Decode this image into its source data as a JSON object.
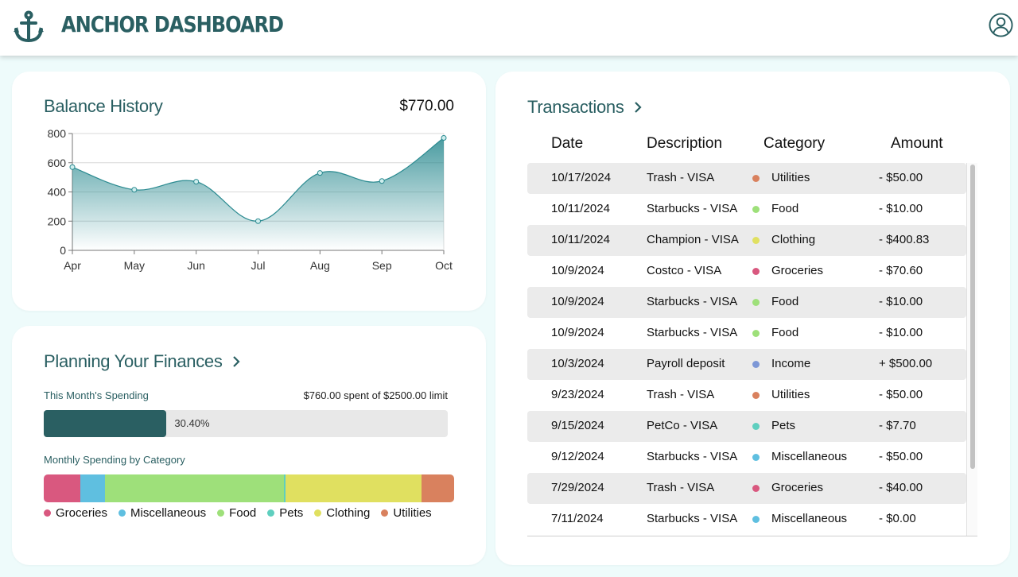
{
  "header": {
    "title": "ANCHOR DASHBOARD",
    "logo_icon": "anchor-icon",
    "profile_icon": "user-circle-icon",
    "brand_color": "#2a5f62"
  },
  "balance": {
    "title": "Balance History",
    "amount": "$770.00"
  },
  "chart_data": {
    "type": "area",
    "categories": [
      "Apr",
      "May",
      "Jun",
      "Jul",
      "Aug",
      "Sep",
      "Oct"
    ],
    "x": [
      "Apr",
      "May",
      "Jun",
      "Jul",
      "Aug",
      "Sep",
      "Oct"
    ],
    "series": [
      {
        "values": [
          570,
          415,
          470,
          200,
          530,
          475,
          770
        ]
      }
    ],
    "yticks": [
      "0",
      "200",
      "400",
      "600",
      "800"
    ],
    "ylim": [
      0,
      800
    ],
    "grid": true,
    "color": "#2a8a90"
  },
  "planning": {
    "title": "Planning Your Finances",
    "spending_label": "This Month's Spending",
    "spending_summary": "$760.00 spent of $2500.00 limit",
    "progress_fraction": 0.304,
    "progress_text": "30.40%",
    "category_label": "Monthly Spending by Category",
    "categories": [
      {
        "name": "Groceries",
        "color": "#d9587f",
        "share": 0.09
      },
      {
        "name": "Miscellaneous",
        "color": "#5fbfe0",
        "share": 0.06
      },
      {
        "name": "Food",
        "color": "#9ee07a",
        "share": 0.435
      },
      {
        "name": "Pets",
        "color": "#5fcfbf",
        "share": 0.005
      },
      {
        "name": "Clothing",
        "color": "#e0e060",
        "share": 0.33
      },
      {
        "name": "Utilities",
        "color": "#d9815e",
        "share": 0.08
      }
    ]
  },
  "transactions": {
    "title": "Transactions",
    "columns": [
      "Date",
      "Description",
      "Category",
      "Amount"
    ],
    "rows": [
      {
        "date": "10/17/2024",
        "description": "Trash - VISA",
        "category": "Utilities",
        "color": "#d9815e",
        "amount": "- $50.00"
      },
      {
        "date": "10/11/2024",
        "description": "Starbucks - VISA",
        "category": "Food",
        "color": "#9ee07a",
        "amount": "- $10.00"
      },
      {
        "date": "10/11/2024",
        "description": "Champion - VISA",
        "category": "Clothing",
        "color": "#e0e060",
        "amount": "- $400.83"
      },
      {
        "date": "10/9/2024",
        "description": "Costco - VISA",
        "category": "Groceries",
        "color": "#d9587f",
        "amount": "- $70.60"
      },
      {
        "date": "10/9/2024",
        "description": "Starbucks - VISA",
        "category": "Food",
        "color": "#9ee07a",
        "amount": "- $10.00"
      },
      {
        "date": "10/9/2024",
        "description": "Starbucks - VISA",
        "category": "Food",
        "color": "#9ee07a",
        "amount": "- $10.00"
      },
      {
        "date": "10/3/2024",
        "description": "Payroll deposit",
        "category": "Income",
        "color": "#7d97d6",
        "amount": "+ $500.00"
      },
      {
        "date": "9/23/2024",
        "description": "Trash - VISA",
        "category": "Utilities",
        "color": "#d9815e",
        "amount": "- $50.00"
      },
      {
        "date": "9/15/2024",
        "description": "PetCo - VISA",
        "category": "Pets",
        "color": "#5fcfbf",
        "amount": "- $7.70"
      },
      {
        "date": "9/12/2024",
        "description": "Starbucks - VISA",
        "category": "Miscellaneous",
        "color": "#5fbfe0",
        "amount": "- $50.00"
      },
      {
        "date": "7/29/2024",
        "description": "Trash - VISA",
        "category": "Groceries",
        "color": "#d9587f",
        "amount": "- $40.00"
      },
      {
        "date": "7/11/2024",
        "description": "Starbucks - VISA",
        "category": "Miscellaneous",
        "color": "#5fbfe0",
        "amount": "- $0.00"
      }
    ]
  }
}
